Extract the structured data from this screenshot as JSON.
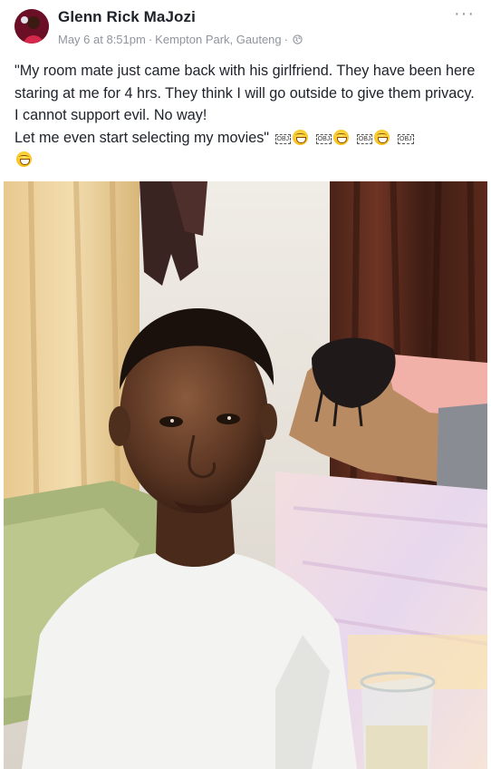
{
  "post": {
    "author": "Glenn Rick MaJozi",
    "date": "May 6 at 8:51pm",
    "separator": "·",
    "location": "Kempton Park, Gauteng",
    "privacy_icon": "globe-icon",
    "more_label": "···",
    "text_lines": [
      "\"My room mate just came back with his girlfriend. They have been here staring at me for 4 hrs. They think I will go outside to give them privacy. I cannot support evil. No way!",
      "Let me even start selecting my movies\""
    ],
    "obj_placeholder": "OBJ",
    "emoji": "laughing-face-icon"
  },
  "colors": {
    "name": "#1d2129",
    "meta": "#90949c",
    "text": "#1d2129"
  }
}
